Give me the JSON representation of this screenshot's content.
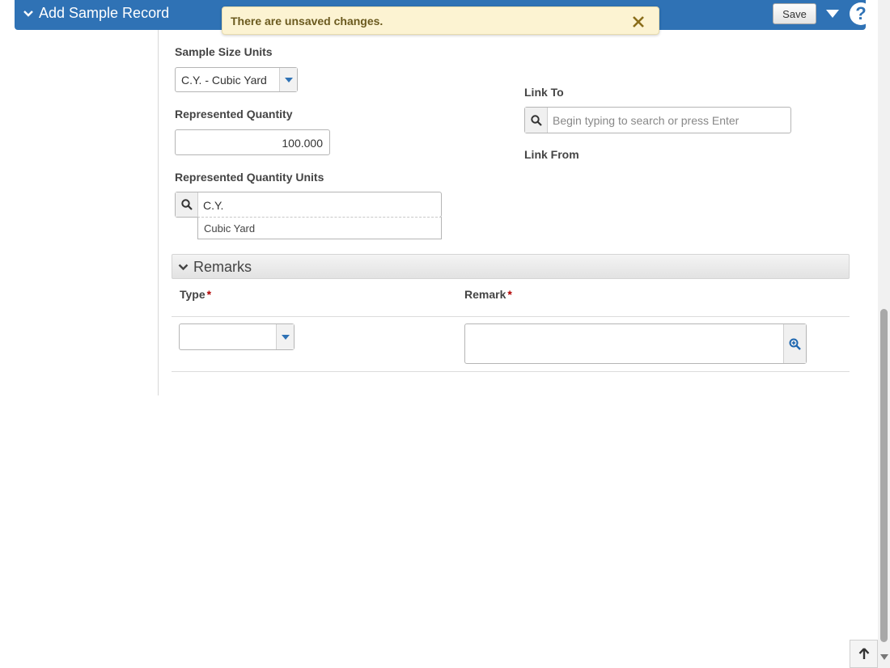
{
  "header": {
    "title": "Add Sample Record",
    "save_label": "Save",
    "help_label": "?",
    "bg_color": "#2f72b5"
  },
  "toast": {
    "message": "There are unsaved changes.",
    "close_icon": "close-icon"
  },
  "form": {
    "sample_size_units": {
      "label": "Sample Size Units",
      "value": "C.Y. - Cubic Yard"
    },
    "represented_quantity": {
      "label": "Represented Quantity",
      "value": "100.000"
    },
    "represented_quantity_units": {
      "label": "Represented Quantity Units",
      "value": "C.Y.",
      "suggestion": "Cubic Yard"
    },
    "link_to": {
      "label": "Link To",
      "placeholder": "Begin typing to search or press Enter"
    },
    "link_from": {
      "label": "Link From"
    }
  },
  "remarks": {
    "section_title": "Remarks",
    "columns": [
      {
        "label": "Type",
        "required_mark": "*"
      },
      {
        "label": "Remark",
        "required_mark": "*"
      }
    ],
    "row": {
      "type_value": "",
      "remark_value": ""
    }
  },
  "colors": {
    "required": "#b10000",
    "toast_bg": "#fcf3d2"
  }
}
